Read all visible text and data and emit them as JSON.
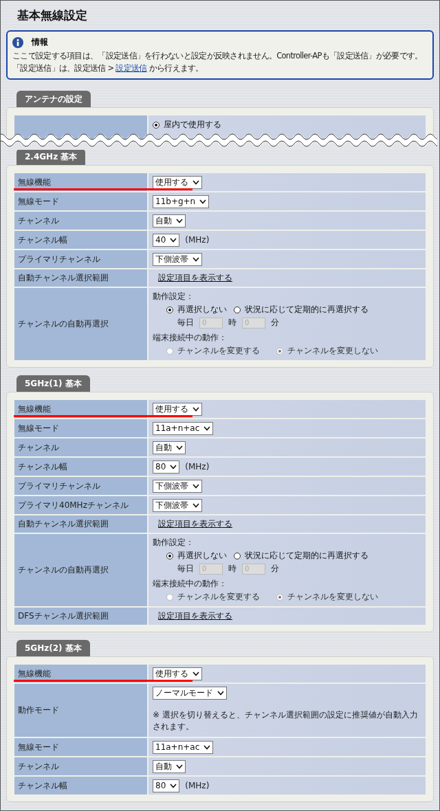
{
  "title": "基本無線設定",
  "info": {
    "heading": "情報",
    "line1": "ここで設定する項目は、「設定送信」を行わないと設定が反映されません。Controller-APも「設定送信」が必要です。",
    "line2_before": "「設定送信」は、設定送信 >",
    "link": "設定送信",
    "line2_after": "から行えます。"
  },
  "antenna": {
    "title": "アンテナの設定",
    "options": [
      {
        "label": "屋内で使用する",
        "selected": true
      }
    ]
  },
  "sections": [
    {
      "title": "2.4GHz 基本",
      "rows": [
        {
          "kind": "select",
          "label": "無線機能",
          "value": "使用する",
          "highlighted": true
        },
        {
          "kind": "select",
          "label": "無線モード",
          "value": "11b+g+n"
        },
        {
          "kind": "select",
          "label": "チャンネル",
          "value": "自動"
        },
        {
          "kind": "select",
          "label": "チャンネル幅",
          "value": "40",
          "unit": "(MHz)"
        },
        {
          "kind": "select",
          "label": "プライマリチャンネル",
          "value": "下側波帯"
        },
        {
          "kind": "link",
          "label": "自動チャンネル選択範囲",
          "link": "設定項目を表示する"
        },
        {
          "kind": "reselect",
          "label": "チャンネルの自動再選択",
          "action_label": "動作設定：",
          "options": [
            {
              "label": "再選択しない",
              "selected": true
            },
            {
              "label": "状況に応じて定期的に再選択する",
              "selected": false
            }
          ],
          "daily_label": "毎日",
          "hour": "0",
          "hour_label": "時",
          "minute": "0",
          "minute_label": "分",
          "fields_disabled": true,
          "connected_label": "端末接続中の動作：",
          "connected_disabled": true,
          "connected_options": [
            {
              "label": "チャンネルを変更する",
              "selected": false
            },
            {
              "label": "チャンネルを変更しない",
              "selected": true
            }
          ]
        }
      ]
    },
    {
      "title": "5GHz(1) 基本",
      "rows": [
        {
          "kind": "select",
          "label": "無線機能",
          "value": "使用する",
          "highlighted": true
        },
        {
          "kind": "select",
          "label": "無線モード",
          "value": "11a+n+ac"
        },
        {
          "kind": "select",
          "label": "チャンネル",
          "value": "自動"
        },
        {
          "kind": "select",
          "label": "チャンネル幅",
          "value": "80",
          "unit": "(MHz)"
        },
        {
          "kind": "select",
          "label": "プライマリチャンネル",
          "value": "下側波帯"
        },
        {
          "kind": "select",
          "label": "プライマリ40MHzチャンネル",
          "value": "下側波帯"
        },
        {
          "kind": "link",
          "label": "自動チャンネル選択範囲",
          "link": "設定項目を表示する"
        },
        {
          "kind": "reselect",
          "label": "チャンネルの自動再選択",
          "action_label": "動作設定：",
          "options": [
            {
              "label": "再選択しない",
              "selected": true
            },
            {
              "label": "状況に応じて定期的に再選択する",
              "selected": false
            }
          ],
          "daily_label": "毎日",
          "hour": "0",
          "hour_label": "時",
          "minute": "0",
          "minute_label": "分",
          "fields_disabled": true,
          "connected_label": "端末接続中の動作：",
          "connected_disabled": true,
          "connected_options": [
            {
              "label": "チャンネルを変更する",
              "selected": false
            },
            {
              "label": "チャンネルを変更しない",
              "selected": true
            }
          ]
        },
        {
          "kind": "link",
          "label": "DFSチャンネル選択範囲",
          "link": "設定項目を表示する"
        }
      ]
    },
    {
      "title": "5GHz(2) 基本",
      "rows": [
        {
          "kind": "select",
          "label": "無線機能",
          "value": "使用する",
          "highlighted": true
        },
        {
          "kind": "select",
          "label": "動作モード",
          "value": "ノーマルモード",
          "note": "※ 選択を切り替えると、チャンネル選択範囲の設定に推奨値が自動入力されます。"
        },
        {
          "kind": "select",
          "label": "無線モード",
          "value": "11a+n+ac"
        },
        {
          "kind": "select",
          "label": "チャンネル",
          "value": "自動"
        },
        {
          "kind": "select",
          "label": "チャンネル幅",
          "value": "80",
          "unit": "(MHz)"
        }
      ]
    }
  ]
}
